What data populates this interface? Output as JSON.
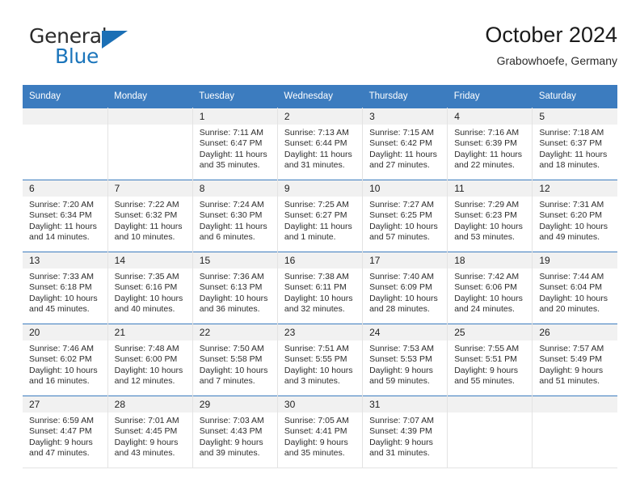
{
  "brand": {
    "name_top": "General",
    "name_bottom": "Blue"
  },
  "header": {
    "title": "October 2024",
    "location": "Grabowhoefe, Germany"
  },
  "colors": {
    "header_blue": "#3c7cbf",
    "logo_blue": "#1b75bb",
    "daynum_band": "#f1f1f1",
    "text": "#2d2d2d"
  },
  "weekday_headers": [
    "Sunday",
    "Monday",
    "Tuesday",
    "Wednesday",
    "Thursday",
    "Friday",
    "Saturday"
  ],
  "labels": {
    "sunrise_prefix": "Sunrise:",
    "sunset_prefix": "Sunset:",
    "daylight_prefix": "Daylight:"
  },
  "weeks": [
    [
      {
        "day": ""
      },
      {
        "day": ""
      },
      {
        "day": "1",
        "sunrise": "Sunrise: 7:11 AM",
        "sunset": "Sunset: 6:47 PM",
        "daylight_line1": "Daylight: 11 hours",
        "daylight_line2": "and 35 minutes."
      },
      {
        "day": "2",
        "sunrise": "Sunrise: 7:13 AM",
        "sunset": "Sunset: 6:44 PM",
        "daylight_line1": "Daylight: 11 hours",
        "daylight_line2": "and 31 minutes."
      },
      {
        "day": "3",
        "sunrise": "Sunrise: 7:15 AM",
        "sunset": "Sunset: 6:42 PM",
        "daylight_line1": "Daylight: 11 hours",
        "daylight_line2": "and 27 minutes."
      },
      {
        "day": "4",
        "sunrise": "Sunrise: 7:16 AM",
        "sunset": "Sunset: 6:39 PM",
        "daylight_line1": "Daylight: 11 hours",
        "daylight_line2": "and 22 minutes."
      },
      {
        "day": "5",
        "sunrise": "Sunrise: 7:18 AM",
        "sunset": "Sunset: 6:37 PM",
        "daylight_line1": "Daylight: 11 hours",
        "daylight_line2": "and 18 minutes."
      }
    ],
    [
      {
        "day": "6",
        "sunrise": "Sunrise: 7:20 AM",
        "sunset": "Sunset: 6:34 PM",
        "daylight_line1": "Daylight: 11 hours",
        "daylight_line2": "and 14 minutes."
      },
      {
        "day": "7",
        "sunrise": "Sunrise: 7:22 AM",
        "sunset": "Sunset: 6:32 PM",
        "daylight_line1": "Daylight: 11 hours",
        "daylight_line2": "and 10 minutes."
      },
      {
        "day": "8",
        "sunrise": "Sunrise: 7:24 AM",
        "sunset": "Sunset: 6:30 PM",
        "daylight_line1": "Daylight: 11 hours",
        "daylight_line2": "and 6 minutes."
      },
      {
        "day": "9",
        "sunrise": "Sunrise: 7:25 AM",
        "sunset": "Sunset: 6:27 PM",
        "daylight_line1": "Daylight: 11 hours",
        "daylight_line2": "and 1 minute."
      },
      {
        "day": "10",
        "sunrise": "Sunrise: 7:27 AM",
        "sunset": "Sunset: 6:25 PM",
        "daylight_line1": "Daylight: 10 hours",
        "daylight_line2": "and 57 minutes."
      },
      {
        "day": "11",
        "sunrise": "Sunrise: 7:29 AM",
        "sunset": "Sunset: 6:23 PM",
        "daylight_line1": "Daylight: 10 hours",
        "daylight_line2": "and 53 minutes."
      },
      {
        "day": "12",
        "sunrise": "Sunrise: 7:31 AM",
        "sunset": "Sunset: 6:20 PM",
        "daylight_line1": "Daylight: 10 hours",
        "daylight_line2": "and 49 minutes."
      }
    ],
    [
      {
        "day": "13",
        "sunrise": "Sunrise: 7:33 AM",
        "sunset": "Sunset: 6:18 PM",
        "daylight_line1": "Daylight: 10 hours",
        "daylight_line2": "and 45 minutes."
      },
      {
        "day": "14",
        "sunrise": "Sunrise: 7:35 AM",
        "sunset": "Sunset: 6:16 PM",
        "daylight_line1": "Daylight: 10 hours",
        "daylight_line2": "and 40 minutes."
      },
      {
        "day": "15",
        "sunrise": "Sunrise: 7:36 AM",
        "sunset": "Sunset: 6:13 PM",
        "daylight_line1": "Daylight: 10 hours",
        "daylight_line2": "and 36 minutes."
      },
      {
        "day": "16",
        "sunrise": "Sunrise: 7:38 AM",
        "sunset": "Sunset: 6:11 PM",
        "daylight_line1": "Daylight: 10 hours",
        "daylight_line2": "and 32 minutes."
      },
      {
        "day": "17",
        "sunrise": "Sunrise: 7:40 AM",
        "sunset": "Sunset: 6:09 PM",
        "daylight_line1": "Daylight: 10 hours",
        "daylight_line2": "and 28 minutes."
      },
      {
        "day": "18",
        "sunrise": "Sunrise: 7:42 AM",
        "sunset": "Sunset: 6:06 PM",
        "daylight_line1": "Daylight: 10 hours",
        "daylight_line2": "and 24 minutes."
      },
      {
        "day": "19",
        "sunrise": "Sunrise: 7:44 AM",
        "sunset": "Sunset: 6:04 PM",
        "daylight_line1": "Daylight: 10 hours",
        "daylight_line2": "and 20 minutes."
      }
    ],
    [
      {
        "day": "20",
        "sunrise": "Sunrise: 7:46 AM",
        "sunset": "Sunset: 6:02 PM",
        "daylight_line1": "Daylight: 10 hours",
        "daylight_line2": "and 16 minutes."
      },
      {
        "day": "21",
        "sunrise": "Sunrise: 7:48 AM",
        "sunset": "Sunset: 6:00 PM",
        "daylight_line1": "Daylight: 10 hours",
        "daylight_line2": "and 12 minutes."
      },
      {
        "day": "22",
        "sunrise": "Sunrise: 7:50 AM",
        "sunset": "Sunset: 5:58 PM",
        "daylight_line1": "Daylight: 10 hours",
        "daylight_line2": "and 7 minutes."
      },
      {
        "day": "23",
        "sunrise": "Sunrise: 7:51 AM",
        "sunset": "Sunset: 5:55 PM",
        "daylight_line1": "Daylight: 10 hours",
        "daylight_line2": "and 3 minutes."
      },
      {
        "day": "24",
        "sunrise": "Sunrise: 7:53 AM",
        "sunset": "Sunset: 5:53 PM",
        "daylight_line1": "Daylight: 9 hours",
        "daylight_line2": "and 59 minutes."
      },
      {
        "day": "25",
        "sunrise": "Sunrise: 7:55 AM",
        "sunset": "Sunset: 5:51 PM",
        "daylight_line1": "Daylight: 9 hours",
        "daylight_line2": "and 55 minutes."
      },
      {
        "day": "26",
        "sunrise": "Sunrise: 7:57 AM",
        "sunset": "Sunset: 5:49 PM",
        "daylight_line1": "Daylight: 9 hours",
        "daylight_line2": "and 51 minutes."
      }
    ],
    [
      {
        "day": "27",
        "sunrise": "Sunrise: 6:59 AM",
        "sunset": "Sunset: 4:47 PM",
        "daylight_line1": "Daylight: 9 hours",
        "daylight_line2": "and 47 minutes."
      },
      {
        "day": "28",
        "sunrise": "Sunrise: 7:01 AM",
        "sunset": "Sunset: 4:45 PM",
        "daylight_line1": "Daylight: 9 hours",
        "daylight_line2": "and 43 minutes."
      },
      {
        "day": "29",
        "sunrise": "Sunrise: 7:03 AM",
        "sunset": "Sunset: 4:43 PM",
        "daylight_line1": "Daylight: 9 hours",
        "daylight_line2": "and 39 minutes."
      },
      {
        "day": "30",
        "sunrise": "Sunrise: 7:05 AM",
        "sunset": "Sunset: 4:41 PM",
        "daylight_line1": "Daylight: 9 hours",
        "daylight_line2": "and 35 minutes."
      },
      {
        "day": "31",
        "sunrise": "Sunrise: 7:07 AM",
        "sunset": "Sunset: 4:39 PM",
        "daylight_line1": "Daylight: 9 hours",
        "daylight_line2": "and 31 minutes."
      },
      {
        "day": ""
      },
      {
        "day": ""
      }
    ]
  ]
}
